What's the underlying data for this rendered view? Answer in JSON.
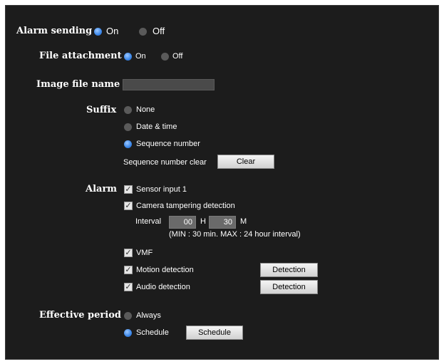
{
  "alarm_sending": {
    "label": "Alarm sending",
    "on_label": "On",
    "off_label": "Off",
    "value": "On"
  },
  "file_attachment": {
    "label": "File attachment",
    "on_label": "On",
    "off_label": "Off",
    "value": "On"
  },
  "image_file_name": {
    "label": "Image file name",
    "value": ""
  },
  "suffix": {
    "label": "Suffix",
    "options": [
      "None",
      "Date & time",
      "Sequence number"
    ],
    "selected": "Sequence number",
    "seq_clear_label": "Sequence number clear",
    "clear_button": "Clear"
  },
  "alarm": {
    "label": "Alarm",
    "sensor_input": "Sensor input 1",
    "camera_tampering": "Camera tampering detection",
    "interval_label": "Interval",
    "interval_hours": "00",
    "hours_unit": "H",
    "interval_minutes": "30",
    "minutes_unit": "M",
    "interval_note": "(MIN : 30 min. MAX : 24 hour interval)",
    "vmf": "VMF",
    "motion_detection": "Motion detection",
    "audio_detection": "Audio detection",
    "detection_button": "Detection"
  },
  "effective_period": {
    "label": "Effective period",
    "always": "Always",
    "schedule": "Schedule",
    "schedule_button": "Schedule",
    "selected": "Schedule"
  }
}
